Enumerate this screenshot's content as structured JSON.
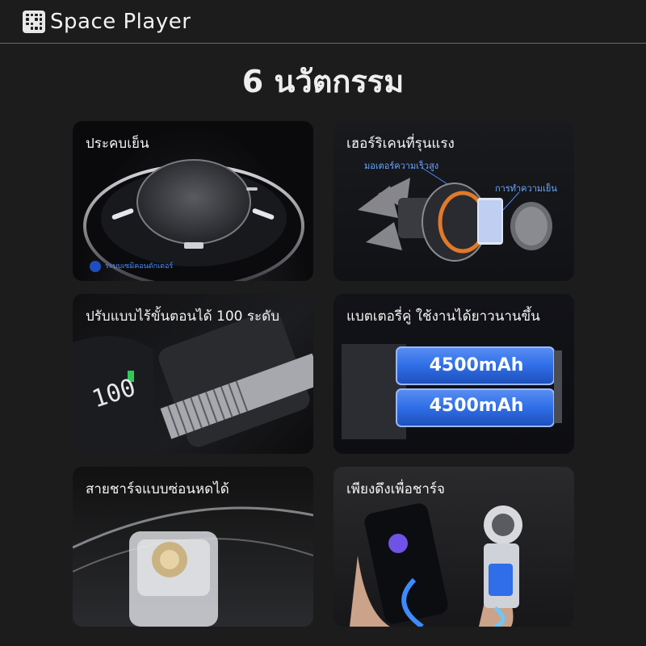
{
  "header": {
    "brand": "Space Player",
    "logo_icon": "grid-logo-icon"
  },
  "headline": "6 นวัตกรรม",
  "cards": [
    {
      "caption": "ประคบเย็น",
      "sublabel": "ระบบเซมิคอนดักเตอร์"
    },
    {
      "caption": "เฮอร์ริเคนที่รุนแรง",
      "label_motor": "มอเตอร์ความเร็วสูง",
      "label_cooling": "การทำความเย็น"
    },
    {
      "caption": "ปรับแบบไร้ขั้นตอนได้ 100 ระดับ",
      "display_value": "100"
    },
    {
      "caption": "แบตเตอรี่คู่ ใช้งานได้ยาวนานขึ้น",
      "battery_top": "4500mAh",
      "battery_bottom": "4500mAh"
    },
    {
      "caption": "สายชาร์จแบบซ่อนหดได้"
    },
    {
      "caption": "เพียงดึงเพื่อชาร์จ"
    }
  ],
  "colors": {
    "background": "#1c1c1d",
    "accent_blue": "#3d8bff",
    "battery_blue": "#2f6ee8"
  }
}
